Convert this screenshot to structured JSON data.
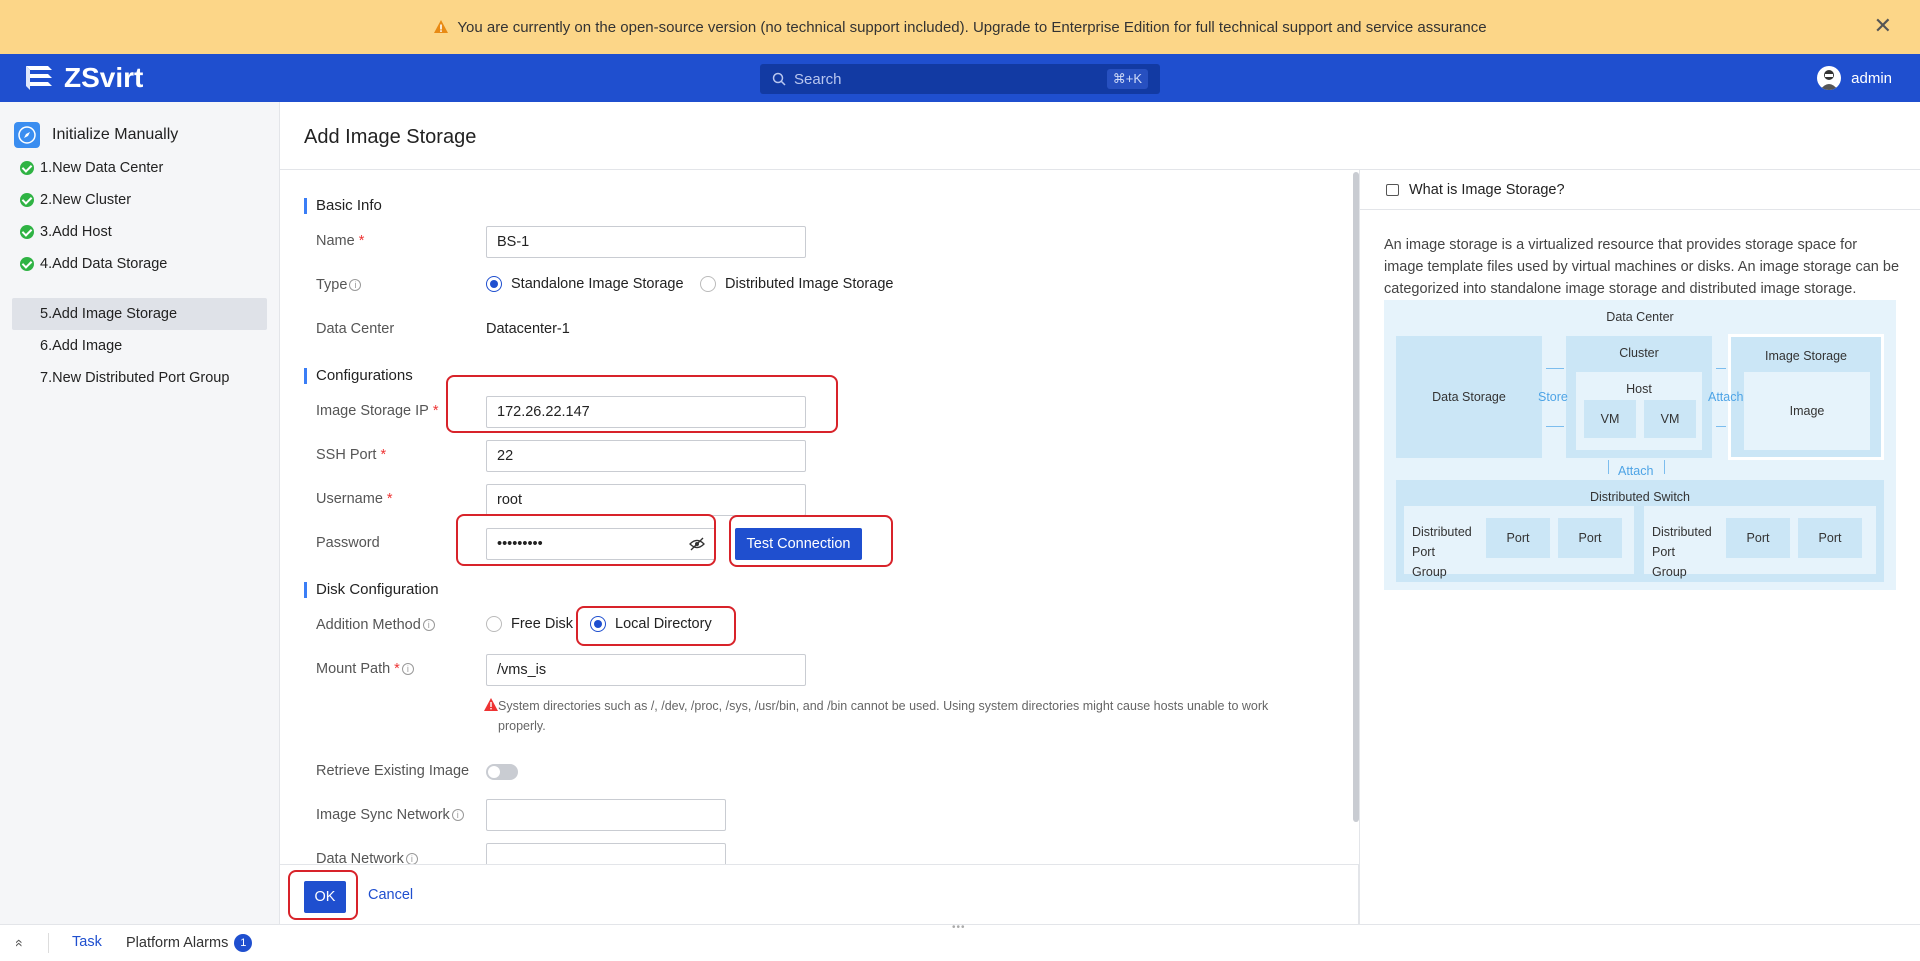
{
  "banner": {
    "message": "You are currently on the open-source version (no technical support included). Upgrade to Enterprise Edition for full technical support and service assurance",
    "close_glyph": "✕"
  },
  "header": {
    "brand": "ZSvirt",
    "search_placeholder": "Search",
    "search_shortcut": "⌘+K",
    "user": "admin"
  },
  "sidebar": {
    "title": "Initialize Manually",
    "steps": [
      {
        "label": "1.New Data Center",
        "done": true
      },
      {
        "label": "2.New Cluster",
        "done": true
      },
      {
        "label": "3.Add Host",
        "done": true
      },
      {
        "label": "4.Add Data Storage",
        "done": true
      },
      {
        "label": "5.Add Image Storage",
        "done": false
      },
      {
        "label": "6.Add Image",
        "done": false
      },
      {
        "label": "7.New Distributed Port Group",
        "done": false
      }
    ]
  },
  "page": {
    "title": "Add Image Storage"
  },
  "form": {
    "basic_info": "Basic Info",
    "name_label": "Name",
    "name_value": "BS-1",
    "type_label": "Type",
    "type_options": [
      "Standalone Image Storage",
      "Distributed Image Storage"
    ],
    "type_selected": "Standalone Image Storage",
    "datacenter_label": "Data Center",
    "datacenter_value": "Datacenter-1",
    "configurations": "Configurations",
    "ip_label": "Image Storage IP",
    "ip_value": "172.26.22.147",
    "ssh_label": "SSH Port",
    "ssh_value": "22",
    "username_label": "Username",
    "username_value": "root",
    "password_label": "Password",
    "password_value": "•••••••••",
    "test_connection": "Test Connection",
    "disk_configuration": "Disk Configuration",
    "addition_label": "Addition Method",
    "addition_options": [
      "Free Disk",
      "Local Directory"
    ],
    "addition_selected": "Local Directory",
    "mount_label": "Mount Path",
    "mount_value": "/vms_is",
    "mount_warning": "System directories such as /, /dev, /proc, /sys, /usr/bin, and /bin cannot be used. Using system directories might cause hosts unable to work properly.",
    "retrieve_label": "Retrieve Existing Image",
    "retrieve_enabled": false,
    "sync_label": "Image Sync Network",
    "data_network_label": "Data Network",
    "required_mark": "*",
    "info_mark": "i"
  },
  "actions": {
    "ok": "OK",
    "cancel": "Cancel"
  },
  "help": {
    "title": "What is Image Storage?",
    "description": "An image storage is a virtualized resource that provides storage space for image template files used by virtual machines or disks. An image storage can be categorized into standalone image storage and distributed image storage.",
    "diagram": {
      "data_center": "Data Center",
      "data_storage": "Data Storage",
      "cluster": "Cluster",
      "host": "Host",
      "vm1": "VM",
      "vm2": "VM",
      "image_storage": "Image Storage",
      "image": "Image",
      "store": "Store",
      "attach_right": "Attach",
      "attach_bottom": "Attach",
      "distributed_switch": "Distributed Switch",
      "dpg1": "Distributed Port Group",
      "dpg2": "Distributed Port Group",
      "port": "Port"
    }
  },
  "bottombar": {
    "expand_glyph": "«",
    "task": "Task",
    "alarms": "Platform Alarms",
    "alarm_count": "1",
    "handle": "•••"
  },
  "colors": {
    "primary": "#1f4fcf",
    "banner": "#fcd688",
    "success": "#2fb344",
    "annotation": "#d8232a"
  }
}
